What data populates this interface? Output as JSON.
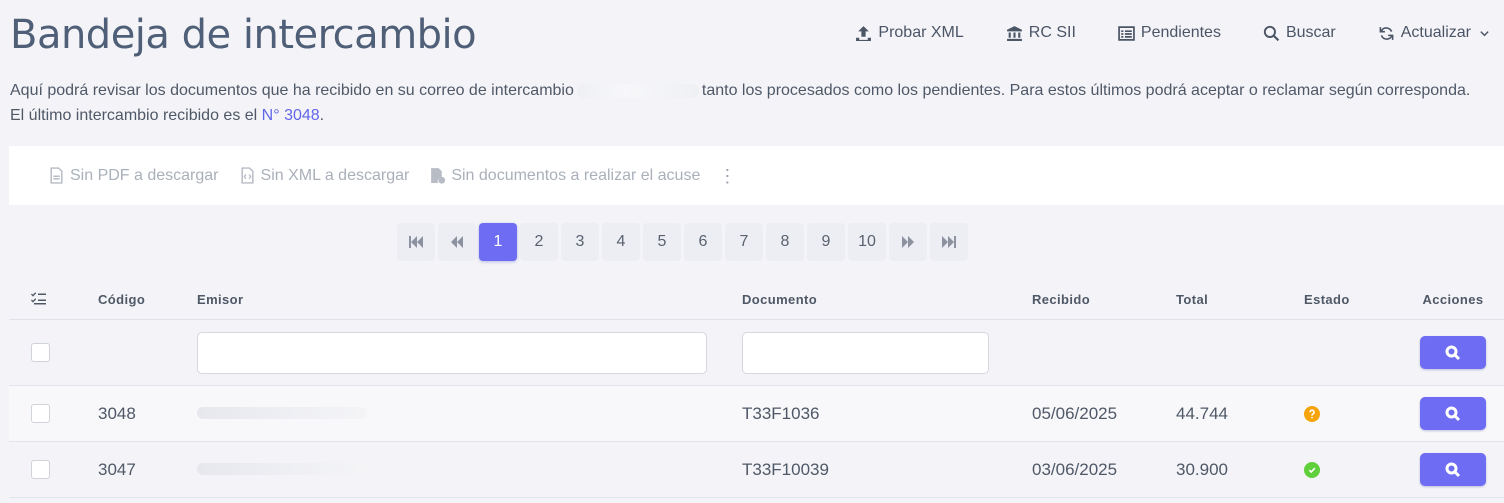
{
  "header": {
    "title": "Bandeja de intercambio",
    "actions": [
      {
        "label": "Probar XML",
        "icon": "upload-icon"
      },
      {
        "label": "RC SII",
        "icon": "bank-icon"
      },
      {
        "label": "Pendientes",
        "icon": "list-icon"
      },
      {
        "label": "Buscar",
        "icon": "search-icon"
      },
      {
        "label": "Actualizar",
        "icon": "refresh-icon"
      }
    ]
  },
  "description": {
    "part1": "Aquí podrá revisar los documentos que ha recibido en su correo de intercambio",
    "part2": "tanto los procesados como los pendientes. Para estos últimos podrá aceptar o reclamar según corresponda. El último intercambio recibido es el",
    "link": "N° 3048",
    "end": "."
  },
  "toolbar": {
    "pdf": "Sin PDF a descargar",
    "xml": "Sin XML a descargar",
    "acuse": "Sin documentos a realizar el acuse"
  },
  "pagination": {
    "pages": [
      "1",
      "2",
      "3",
      "4",
      "5",
      "6",
      "7",
      "8",
      "9",
      "10"
    ],
    "current": "1"
  },
  "table": {
    "columns": {
      "codigo": "Código",
      "emisor": "Emisor",
      "documento": "Documento",
      "recibido": "Recibido",
      "total": "Total",
      "estado": "Estado",
      "acciones": "Acciones"
    },
    "rows": [
      {
        "codigo": "3048",
        "documento": "T33F1036",
        "recibido": "05/06/2025",
        "total": "44.744",
        "estado": "pending",
        "estado_color": "#f5a50b"
      },
      {
        "codigo": "3047",
        "documento": "T33F10039",
        "recibido": "03/06/2025",
        "total": "30.900",
        "estado": "ok",
        "estado_color": "#5fcf3b"
      }
    ]
  },
  "colors": {
    "accent": "#6d6cf2",
    "link": "#6065e8"
  }
}
